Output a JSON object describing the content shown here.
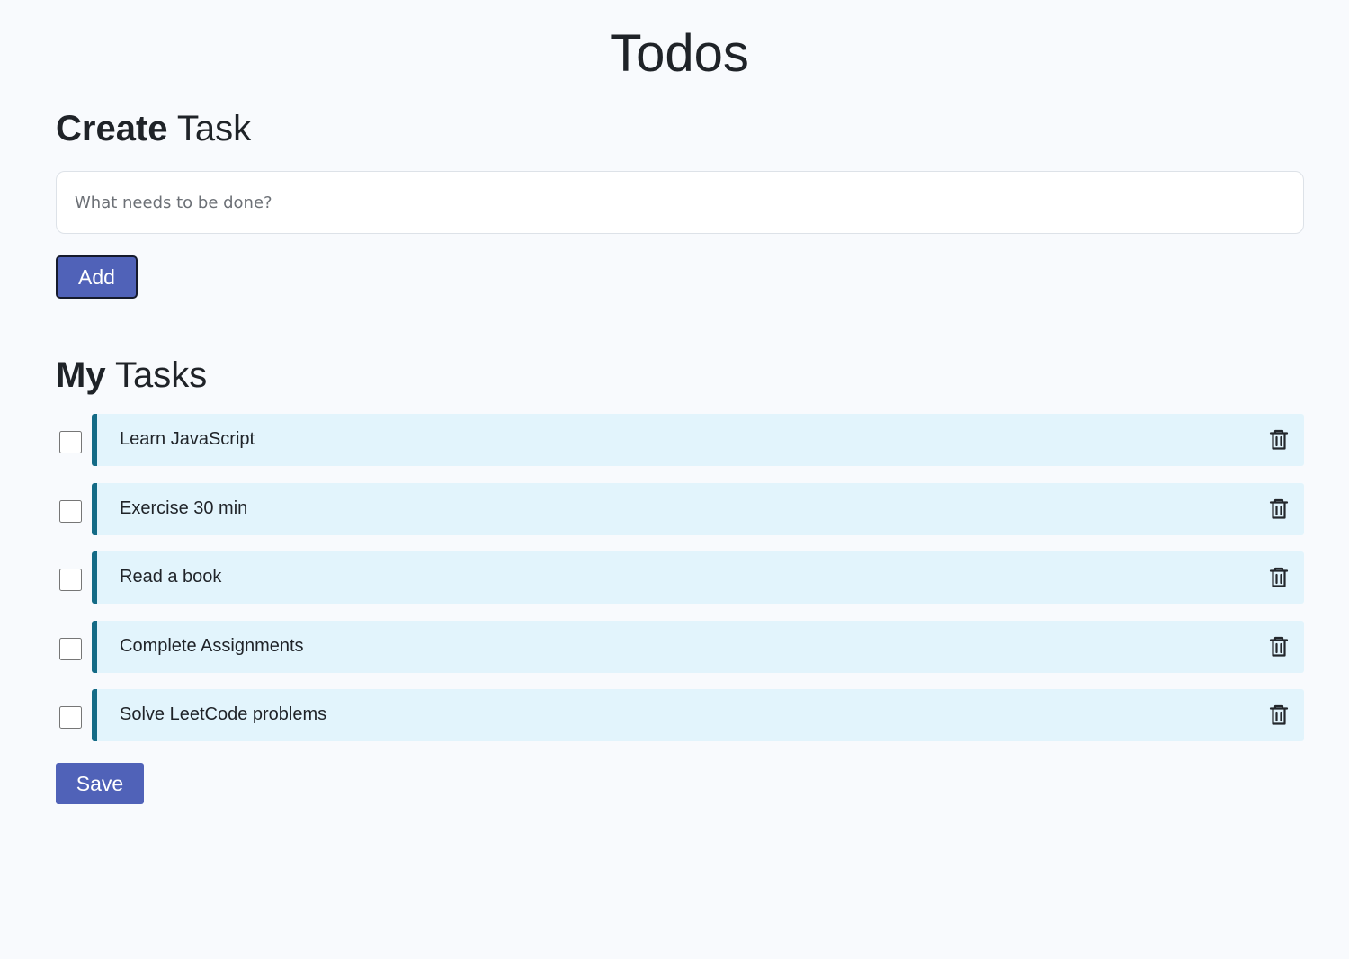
{
  "header": {
    "title": "Todos"
  },
  "create": {
    "heading_strong": "Create",
    "heading_rest": " Task",
    "input_placeholder": "What needs to be done?",
    "input_value": "",
    "add_label": "Add"
  },
  "tasks": {
    "heading_strong": "My",
    "heading_rest": " Tasks",
    "items": [
      {
        "label": "Learn JavaScript",
        "checked": false
      },
      {
        "label": "Exercise 30 min",
        "checked": false
      },
      {
        "label": "Read a book",
        "checked": false
      },
      {
        "label": "Complete Assignments",
        "checked": false
      },
      {
        "label": "Solve LeetCode problems",
        "checked": false
      }
    ],
    "delete_icon": "trash-icon",
    "save_label": "Save"
  },
  "colors": {
    "background": "#f8fafd",
    "primary_button": "#5062b8",
    "task_card": "#e2f4fc",
    "task_accent": "#146b86"
  }
}
